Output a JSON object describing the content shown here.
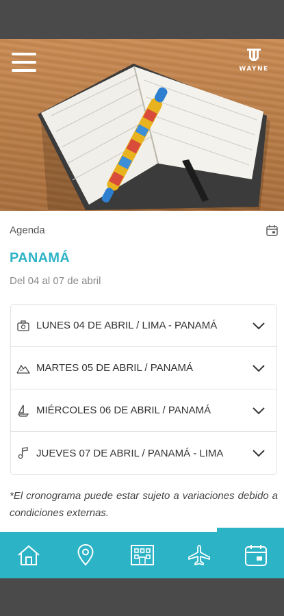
{
  "header": {
    "menu_icon": "hamburger-icon",
    "brand_name": "WAYNE"
  },
  "page": {
    "breadcrumb": "Agenda",
    "title": "PANAMÁ",
    "date_range": "Del 04 al 07 de abril",
    "calendar_icon": "calendar-icon"
  },
  "itinerary": [
    {
      "label": "LUNES 04 DE ABRIL / LIMA - PANAMÁ",
      "icon": "luggage-icon"
    },
    {
      "label": "MARTES 05 DE ABRIL / PANAMÁ",
      "icon": "mountain-icon"
    },
    {
      "label": "MIÉRCOLES 06 DE ABRIL / PANAMÁ",
      "icon": "sailboat-icon"
    },
    {
      "label": "JUEVES 07 DE ABRIL / PANAMÁ - LIMA",
      "icon": "music-note-icon"
    }
  ],
  "note": "*El cronograma puede estar sujeto a variaciones debido a condiciones externas.",
  "tabs": [
    {
      "name": "home",
      "icon": "home-icon"
    },
    {
      "name": "location",
      "icon": "location-pin-icon"
    },
    {
      "name": "hotel",
      "icon": "hotel-icon"
    },
    {
      "name": "flights",
      "icon": "airplane-icon"
    },
    {
      "name": "agenda",
      "icon": "calendar-icon",
      "active": true
    }
  ],
  "colors": {
    "accent": "#2db3c6",
    "system_bars": "#4a4a4a",
    "text": "#333333"
  }
}
